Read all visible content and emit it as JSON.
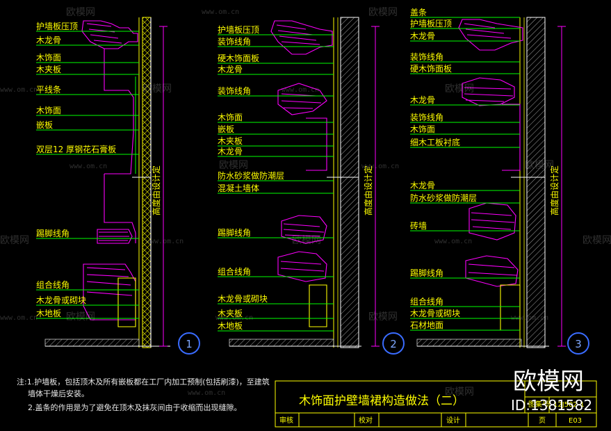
{
  "sections": [
    {
      "number": "1",
      "height_label": "高度由设计定",
      "labels": [
        "护墙板压顶",
        "木龙骨",
        "木饰面",
        "木夹板",
        "平线条",
        "木饰面",
        "嵌板",
        "双层12  厚钢花石膏板",
        "踢脚线角",
        "组合线角",
        "木龙骨或砌块",
        "木地板"
      ]
    },
    {
      "number": "2",
      "height_label": "高度由设计定",
      "labels": [
        "护墙板压顶",
        "装饰线角",
        "硬木饰面板",
        "木龙骨",
        "装饰线角",
        "木饰面",
        "嵌板",
        "木夹板",
        "木龙骨",
        "防水砂浆做防潮层",
        "混凝土墙体",
        "踢脚线角",
        "组合线角",
        "木龙骨或砌块",
        "木夹板",
        "木地板"
      ]
    },
    {
      "number": "3",
      "height_label": "高度由设计定",
      "labels": [
        "盖条",
        "护墙板压顶",
        "木龙骨",
        "装饰线角",
        "硬木饰面板",
        "木龙骨",
        "装饰线角",
        "木饰面",
        "细木工板衬底",
        "木龙骨",
        "防水砂浆做防潮层",
        "砖墙",
        "踢脚线角",
        "组合线角",
        "木龙骨或砌块",
        "石材地面"
      ]
    }
  ],
  "notes": [
    "注:1.护墙板，包括顶木及所有嵌板都在工厂内加工预制(包括刷漆)，至建筑",
    "墙体干燥后安装。",
    "2.盖条的作用是为了避免在顶木及抹灰间由于收缩而出现缝隙。"
  ],
  "title_block": {
    "title": "木饰面护壁墙裙构造做法（二）",
    "atlas_label": "图集号",
    "atlas_no": "12J502-1",
    "review": "审核",
    "check": "校对",
    "design": "设计",
    "page_label": "页",
    "page_no": "E03"
  },
  "watermark": {
    "brand": "欧模网",
    "site": "www.om.cn",
    "id": "ID:1381582"
  },
  "colors": {
    "background": "#000000",
    "label": "#ffff00",
    "leader": "#00ff00",
    "profile": "#ff00ff",
    "wall": "#ffffff",
    "dimension": "#ff00ff",
    "section_circle": "#3a6cff"
  }
}
